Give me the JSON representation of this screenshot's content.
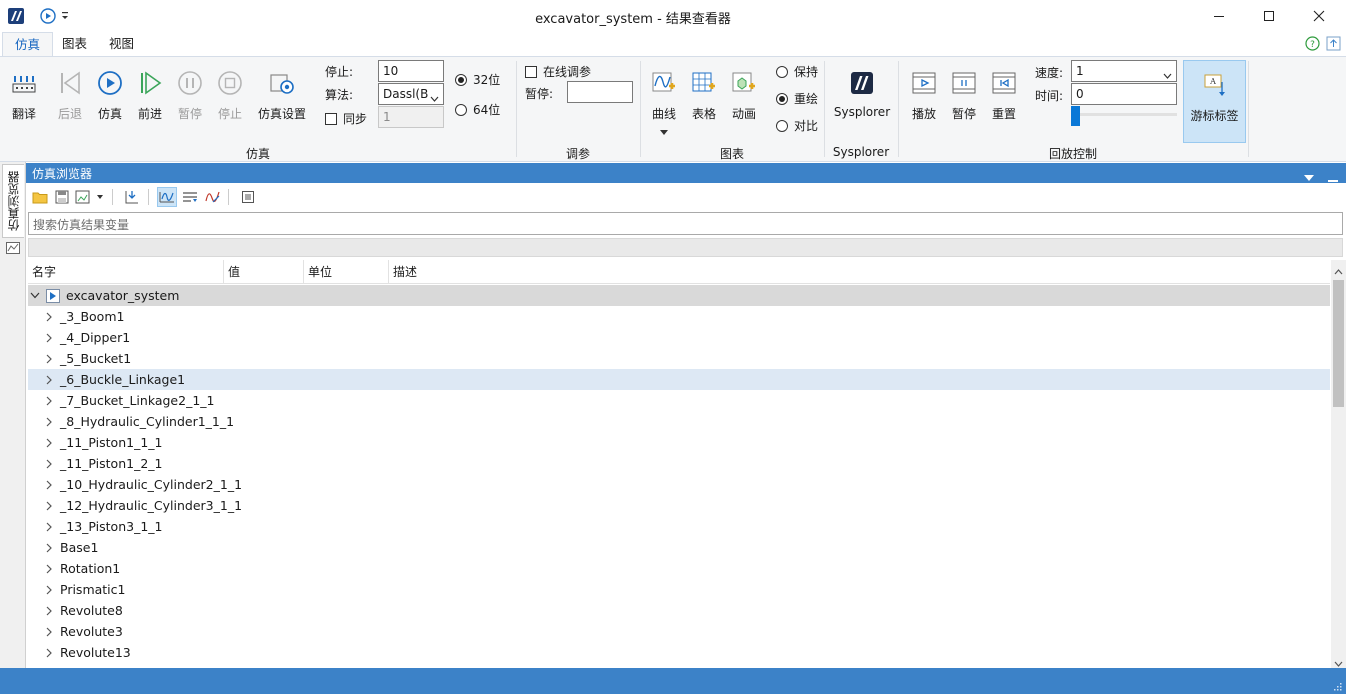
{
  "window": {
    "title": "excavator_system - 结果查看器",
    "colors": {
      "accent": "#3c82c8",
      "tab_active": "#1565c0",
      "selected_row": "#dde8f4"
    }
  },
  "tabs": [
    {
      "label": "仿真",
      "active": true
    },
    {
      "label": "图表",
      "active": false
    },
    {
      "label": "视图",
      "active": false
    }
  ],
  "ribbon": {
    "sim_buttons": {
      "translate": "翻译",
      "back": "后退",
      "simulate": "仿真",
      "forward": "前进",
      "pause": "暂停",
      "stop": "停止",
      "settings": "仿真设置"
    },
    "sim_fields": {
      "stop_label": "停止:",
      "stop_value": "10",
      "algo_label": "算法:",
      "algo_value": "Dassl(B",
      "sync_label": "同步",
      "sync_value": "1",
      "bit32": "32位",
      "bit64": "64位"
    },
    "group_sim": "仿真",
    "tune": {
      "online_label": "在线调参",
      "pause_label": "暂停:",
      "pause_value": ""
    },
    "group_tune": "调参",
    "chart_buttons": {
      "curve": "曲线",
      "table": "表格",
      "anim": "动画"
    },
    "chart_opts": {
      "keep": "保持",
      "redraw": "重绘",
      "compare": "对比"
    },
    "group_chart": "图表",
    "sysplorer": "Sysplorer",
    "group_sysplorer": "Sysplorer",
    "playback": {
      "play": "播放",
      "pause": "暂停",
      "reset": "重置"
    },
    "playback_fields": {
      "speed_label": "速度:",
      "speed_value": "1",
      "time_label": "时间:",
      "time_value": "0"
    },
    "cursor_label": "游标标签",
    "group_playback": "回放控制"
  },
  "left_tab": "仿真浏览器",
  "panel": {
    "title": "仿真浏览器",
    "search_placeholder": "搜索仿真结果变量",
    "columns": [
      "名字",
      "值",
      "单位",
      "描述"
    ],
    "root": "excavator_system",
    "items": [
      "_3_Boom1",
      "_4_Dipper1",
      "_5_Bucket1",
      "_6_Buckle_Linkage1",
      "_7_Bucket_Linkage2_1_1",
      "_8_Hydraulic_Cylinder1_1_1",
      "_11_Piston1_1_1",
      "_11_Piston1_2_1",
      "_10_Hydraulic_Cylinder2_1_1",
      "_12_Hydraulic_Cylinder3_1_1",
      "_13_Piston3_1_1",
      "Base1",
      "Rotation1",
      "Prismatic1",
      "Revolute8",
      "Revolute3",
      "Revolute13"
    ],
    "selected_item": "_6_Buckle_Linkage1"
  }
}
